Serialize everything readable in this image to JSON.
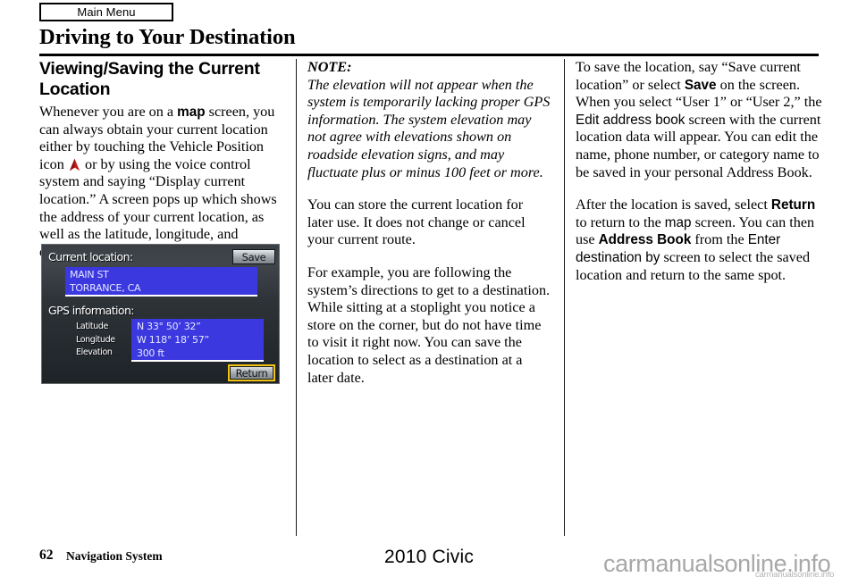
{
  "header": {
    "tab_label": "Main Menu",
    "chapter_title": "Driving to Your Destination"
  },
  "columns": {
    "left": {
      "section_heading": "Viewing/Saving the Current Location",
      "para1_a": "Whenever you are on a ",
      "para1_map": "map",
      "para1_b": " screen, you can always obtain your current location either by touching the Vehicle Position icon ",
      "para1_c": " or by using the voice control system and saying “Display current location.” A screen pops up which shows the address of your current location, as well as the latitude, longitude, and elevation."
    },
    "middle": {
      "note_label": "NOTE:",
      "note_body": "The elevation will not appear when the system is temporarily lacking proper GPS information. The system elevation may not agree with elevations shown on roadside elevation signs, and may fluctuate plus or minus 100 feet or more.",
      "para2": "You can store the current location for later use. It does not change or cancel your current route.",
      "para3": "For example, you are following the system’s directions to get to a destination. While sitting at a stoplight you notice a store on the corner, but do not have time to visit it right now. You can save the location to select as a destination at a later date."
    },
    "right": {
      "para1_a": "To save the location, say “Save current location” or select ",
      "para1_save": "Save",
      "para1_b": " on the screen. When you select “User 1” or “User 2,” the ",
      "para1_edit": "Edit address book",
      "para1_c": " screen with the current location data will appear. You can edit the name, phone number, or category name to be saved in your personal Address Book.",
      "para2_a": "After the location is saved, select ",
      "para2_return": "Return",
      "para2_b": " to return to the ",
      "para2_map": "map",
      "para2_c": " screen. You can then use ",
      "para2_addressbook": "Address Book",
      "para2_d": " from the ",
      "para2_enterdest": "Enter destination by",
      "para2_e": " screen to select the saved location and return to the same spot."
    }
  },
  "nav_screen": {
    "current_location_label": "Current location:",
    "address_line1": "MAIN ST",
    "address_line2": "TORRANCE, CA",
    "gps_information_label": "GPS information:",
    "gps_rows": [
      {
        "name": "Latitude",
        "value": "N 33° 50’ 32”"
      },
      {
        "name": "Longitude",
        "value": "W 118° 18’ 57”"
      },
      {
        "name": "Elevation",
        "value": "300 ft"
      }
    ],
    "save_button": "Save",
    "return_button": "Return",
    "colors": {
      "field_blue": "#3b38e0",
      "selection_yellow": "#f2c312"
    }
  },
  "footer": {
    "page_number": "62",
    "section_name": "Navigation System",
    "model_year": "2010 Civic",
    "watermark": "carmanualsonline.info",
    "watermark_small": "carmanualsonline.info"
  }
}
